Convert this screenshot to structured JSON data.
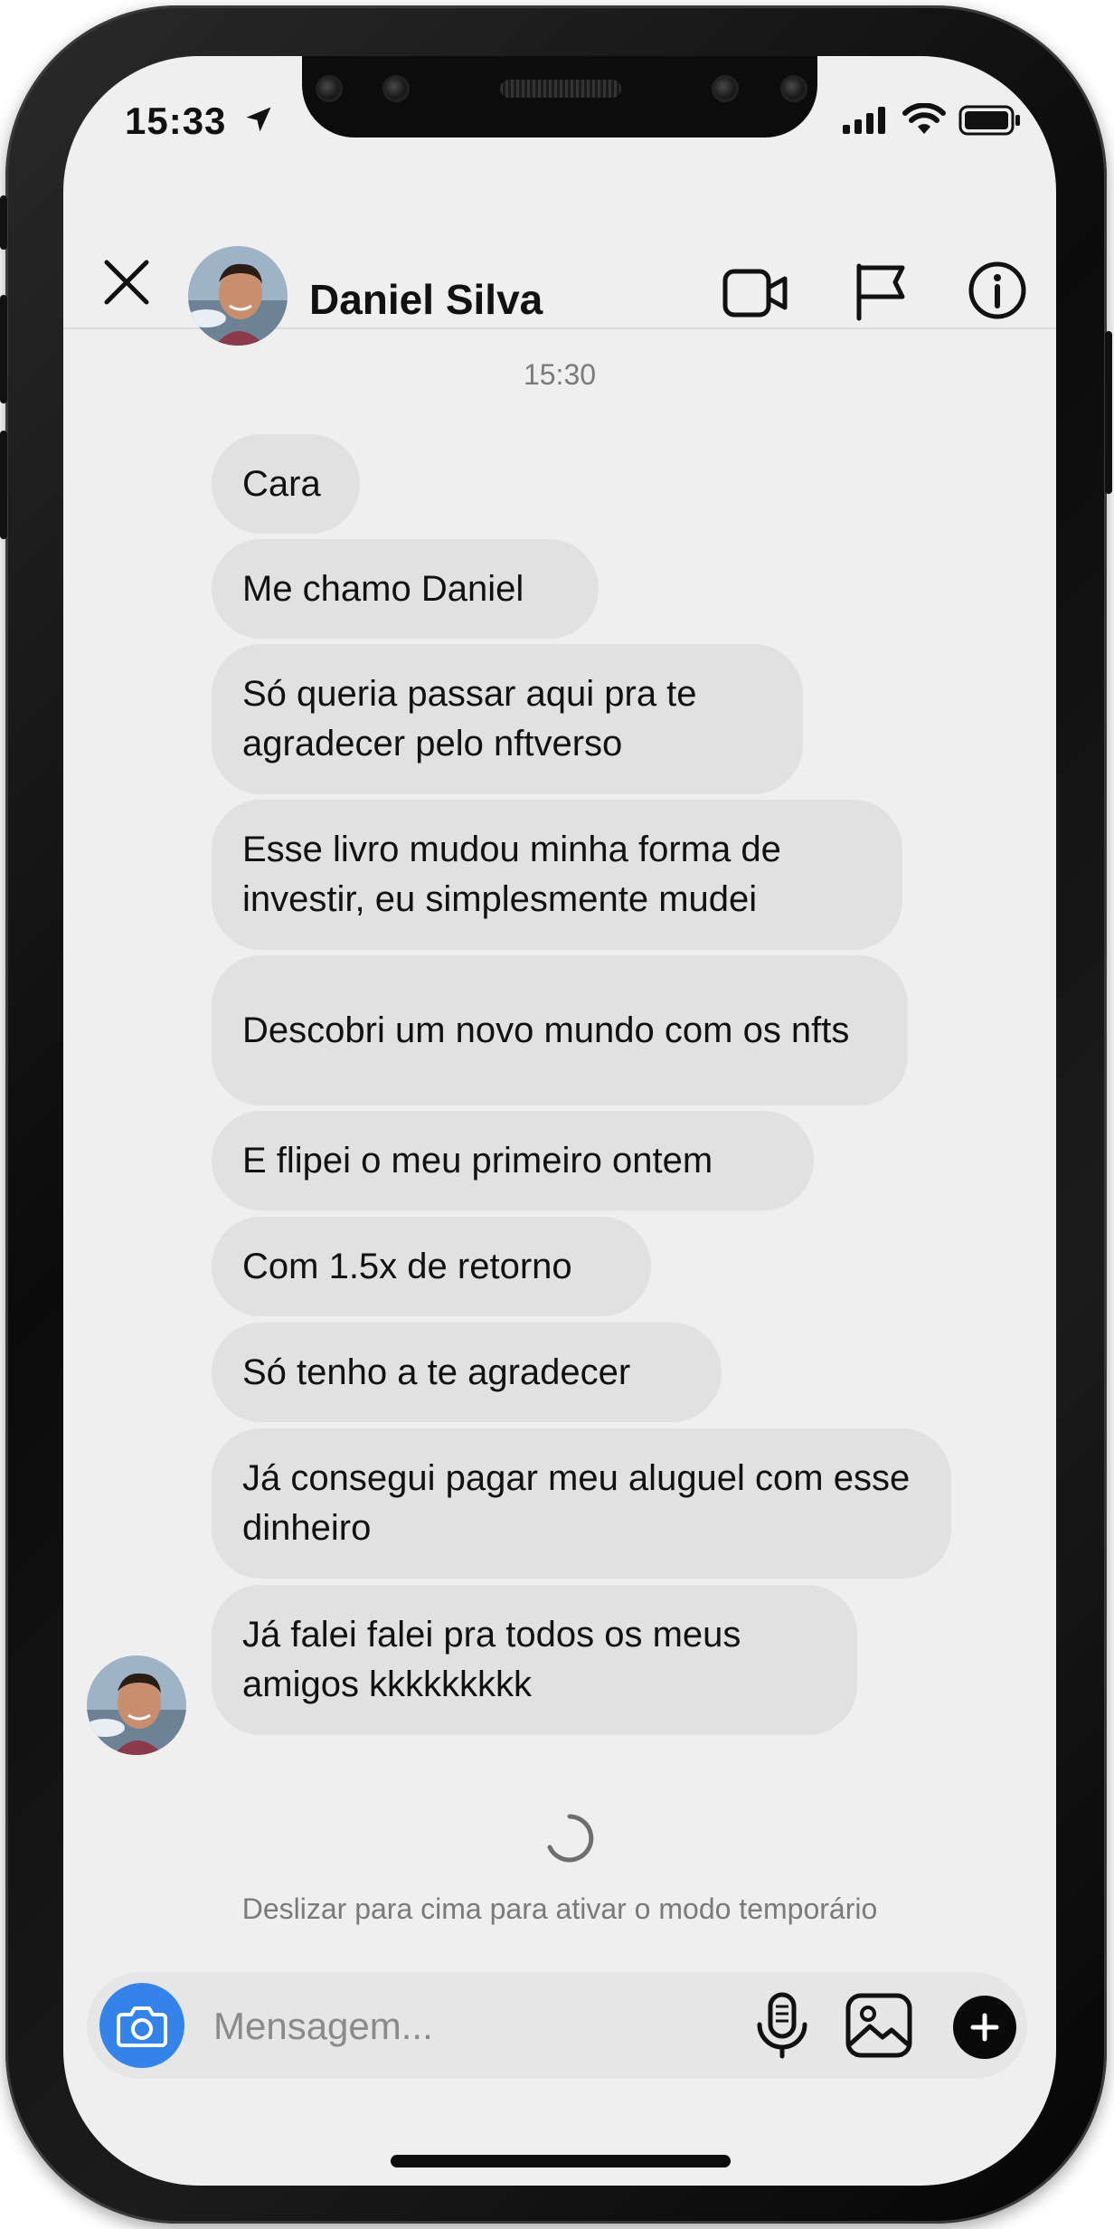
{
  "status_bar": {
    "time": "15:33"
  },
  "header": {
    "contact_name": "Daniel Silva",
    "icons": [
      "close-icon",
      "video-camera-icon",
      "flag-icon",
      "info-icon"
    ]
  },
  "chat": {
    "timestamp": "15:30",
    "messages": [
      "Cara",
      "Me chamo Daniel",
      "Só queria passar aqui pra te agradecer pelo nftverso",
      "Esse livro mudou minha forma de investir, eu simplesmente mudei",
      "Descobri um novo mundo com os nfts",
      "E flipei o meu primeiro ontem",
      "Com 1.5x de retorno",
      "Só tenho a te agradecer",
      "Já consegui pagar meu aluguel com esse dinheiro",
      "Já falei falei pra todos os meus amigos kkkkkkkkk"
    ],
    "swipe_hint": "Deslizar para cima para ativar o modo temporário"
  },
  "composer": {
    "placeholder": "Mensagem...",
    "icons": [
      "camera-icon",
      "microphone-icon",
      "gallery-icon",
      "plus-icon"
    ]
  },
  "colors": {
    "bubble": "#e1e1e1",
    "camera_button": "#3483e8",
    "screen_background": "#efefef"
  }
}
